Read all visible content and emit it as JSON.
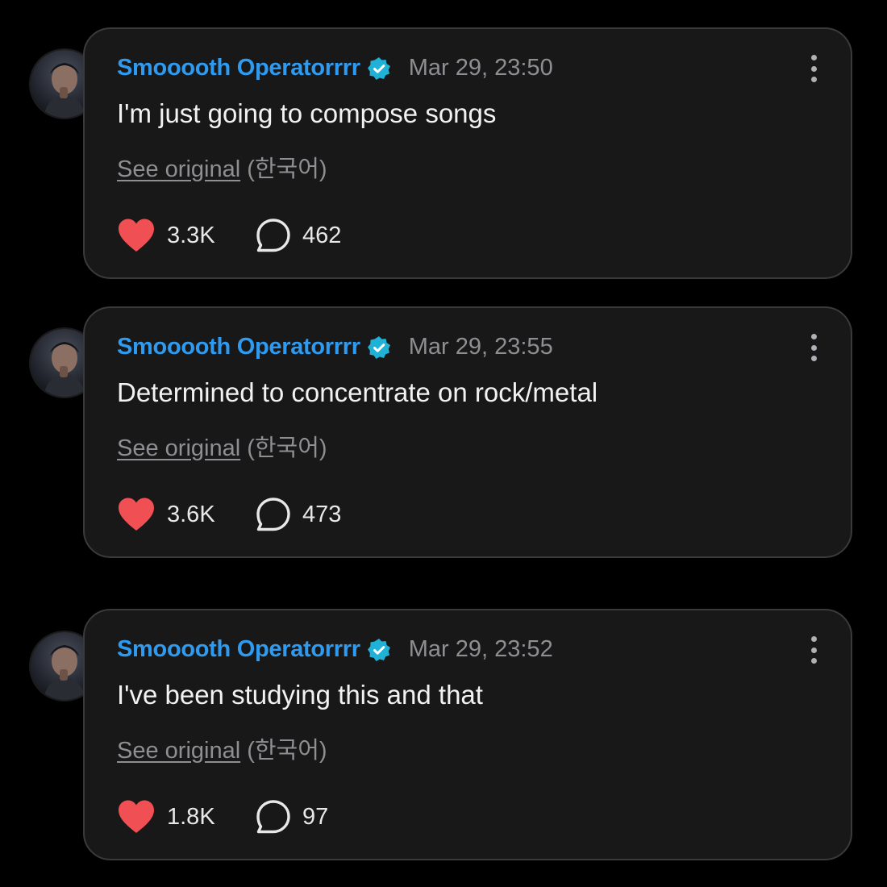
{
  "posts": [
    {
      "username": "Smooooth Operatorrrr",
      "timestamp": "Mar 29, 23:50",
      "text": "I'm just going to compose songs",
      "see_original": "See original",
      "language": "(한국어)",
      "likes": "3.3K",
      "comments": "462"
    },
    {
      "username": "Smooooth Operatorrrr",
      "timestamp": "Mar 29, 23:55",
      "text": "Determined to concentrate on rock/metal",
      "see_original": "See original",
      "language": "(한국어)",
      "likes": "3.6K",
      "comments": "473"
    },
    {
      "username": "Smooooth Operatorrrr",
      "timestamp": "Mar 29, 23:52",
      "text": "I've been studying this and that",
      "see_original": "See original",
      "language": "(한국어)",
      "likes": "1.8K",
      "comments": "97"
    }
  ],
  "icons": {
    "verified": "verified-badge-icon",
    "more": "more-options-icon",
    "like": "heart-icon",
    "comment": "comment-bubble-icon"
  },
  "colors": {
    "background": "#000000",
    "card": "#181818",
    "card_border": "#3a3a3c",
    "username": "#2f9bf0",
    "verified_badge": "#1fb2d6",
    "heart": "#f04f54",
    "muted_text": "#8e8e93",
    "body_text": "#f2f2f2"
  }
}
